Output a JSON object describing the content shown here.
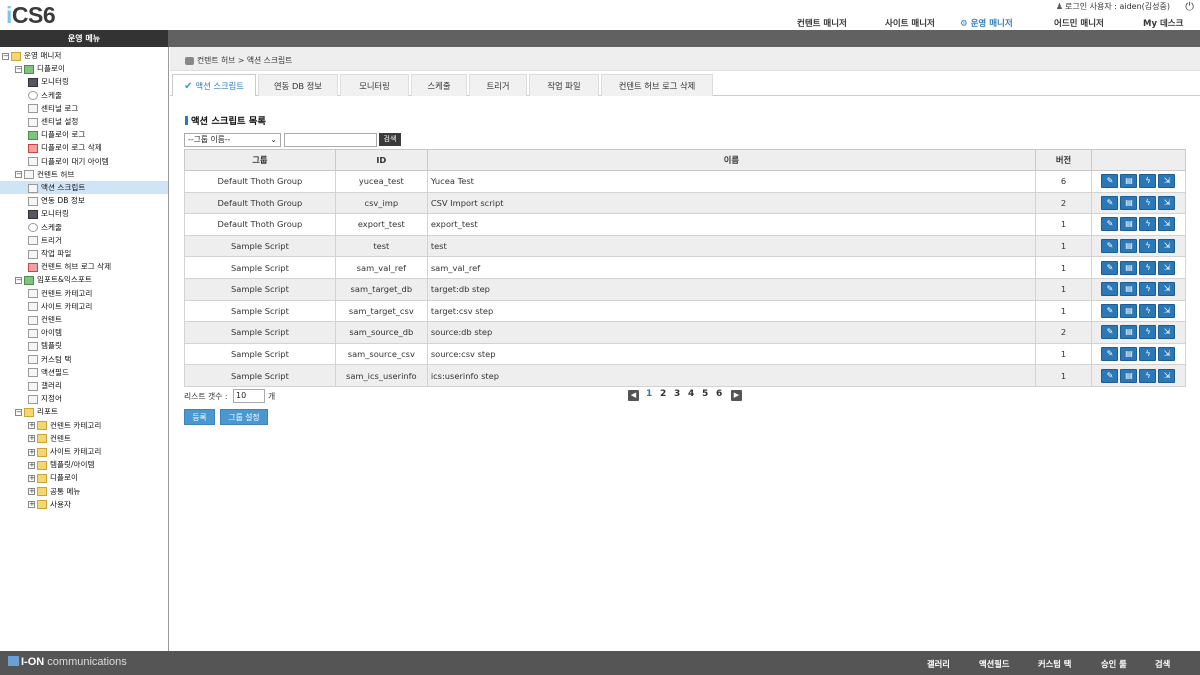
{
  "logo": "iCS6",
  "user_text": "로그인 사용자 : aiden(김성중)",
  "topnav": [
    "컨텐트 매니저",
    "사이트 매니저",
    "운영 매니저",
    "어드민 매니저",
    "My 데스크"
  ],
  "menu_title": "운영 메뉴",
  "tree": [
    {
      "label": "운영 매니저",
      "pm": "−",
      "icon": "folder"
    },
    {
      "label": "디플로이",
      "pm": "−",
      "icon": "green"
    },
    {
      "label": "모니터링",
      "icon": "monitor"
    },
    {
      "label": "스케줄",
      "icon": "clock"
    },
    {
      "label": "센티널 로그",
      "icon": "doc"
    },
    {
      "label": "센티널 설정",
      "icon": "doc"
    },
    {
      "label": "디플로이 로그",
      "icon": "green"
    },
    {
      "label": "디플로이 로그 삭제",
      "icon": "red"
    },
    {
      "label": "디플로이 대기 아이템",
      "icon": "doc"
    },
    {
      "label": "컨텐트 허브",
      "pm": "−",
      "icon": "doc"
    },
    {
      "label": "액션 스크립트",
      "icon": "doc"
    },
    {
      "label": "연동 DB 정보",
      "icon": "doc"
    },
    {
      "label": "모니터링",
      "icon": "monitor"
    },
    {
      "label": "스케줄",
      "icon": "clock"
    },
    {
      "label": "트리거",
      "icon": "doc"
    },
    {
      "label": "작업 파일",
      "icon": "doc"
    },
    {
      "label": "컨텐트 허브 로그 삭제",
      "icon": "red"
    },
    {
      "label": "임포트&익스포트",
      "pm": "−",
      "icon": "green"
    },
    {
      "label": "컨텐트 카테고리",
      "icon": "doc"
    },
    {
      "label": "사이트 카테고리",
      "icon": "doc"
    },
    {
      "label": "컨텐트",
      "icon": "doc"
    },
    {
      "label": "아이템",
      "icon": "doc"
    },
    {
      "label": "템플릿",
      "icon": "doc"
    },
    {
      "label": "커스텀 택",
      "icon": "doc"
    },
    {
      "label": "액션필드",
      "icon": "doc"
    },
    {
      "label": "갤러리",
      "icon": "doc"
    },
    {
      "label": "지정어",
      "icon": "doc"
    },
    {
      "label": "리포트",
      "pm": "−",
      "icon": "folder"
    },
    {
      "label": "컨텐트 카테고리",
      "pm": "+",
      "icon": "folder"
    },
    {
      "label": "컨텐트",
      "pm": "+",
      "icon": "folder"
    },
    {
      "label": "사이트 카테고리",
      "pm": "+",
      "icon": "folder"
    },
    {
      "label": "템플릿/아이템",
      "pm": "+",
      "icon": "folder"
    },
    {
      "label": "디플로이",
      "pm": "+",
      "icon": "folder"
    },
    {
      "label": "공통 메뉴",
      "pm": "+",
      "icon": "folder"
    },
    {
      "label": "사용자",
      "pm": "+",
      "icon": "folder"
    }
  ],
  "breadcrumb": "컨텐트 허브 > 액션 스크립트",
  "tabs": [
    "액션 스크립트",
    "연동 DB 정보",
    "모니터링",
    "스케줄",
    "트리거",
    "작업 파일",
    "컨텐트 허브 로그 삭제"
  ],
  "section_title": "액션 스크립트 목록",
  "group_select": "--그룹 이름--",
  "search_button": "검색",
  "table": {
    "headers": [
      "그룹",
      "ID",
      "이름",
      "버전",
      ""
    ],
    "rows": [
      [
        "Default Thoth Group",
        "yucea_test",
        "Yucea Test",
        "6"
      ],
      [
        "Default Thoth Group",
        "csv_imp",
        "CSV Import script",
        "2"
      ],
      [
        "Default Thoth Group",
        "export_test",
        "export_test",
        "1"
      ],
      [
        "Sample Script",
        "test",
        "test",
        "1"
      ],
      [
        "Sample Script",
        "sam_val_ref",
        "sam_val_ref",
        "1"
      ],
      [
        "Sample Script",
        "sam_target_db",
        "target:db step",
        "1"
      ],
      [
        "Sample Script",
        "sam_target_csv",
        "target:csv step",
        "1"
      ],
      [
        "Sample Script",
        "sam_source_db",
        "source:db step",
        "2"
      ],
      [
        "Sample Script",
        "sam_source_csv",
        "source:csv step",
        "1"
      ],
      [
        "Sample Script",
        "sam_ics_userinfo",
        "ics:userinfo step",
        "1"
      ]
    ]
  },
  "list_count_label": "리스트 갯수 :",
  "list_count_value": "10",
  "list_count_unit": "개",
  "pages": [
    "1",
    "2",
    "3",
    "4",
    "5",
    "6"
  ],
  "buttons": {
    "register": "등록",
    "group_settings": "그룹 설정"
  },
  "footer_logo": "I-ON",
  "footer_logo_suffix": "communications",
  "footer_links": [
    "갤러리",
    "액션필드",
    "커스텀 택",
    "승인 룰",
    "검색"
  ],
  "colors": {
    "accent": "#2a78b8",
    "active_nav": "#2f7bbf",
    "menubar": "#616161",
    "footer": "#555555"
  }
}
